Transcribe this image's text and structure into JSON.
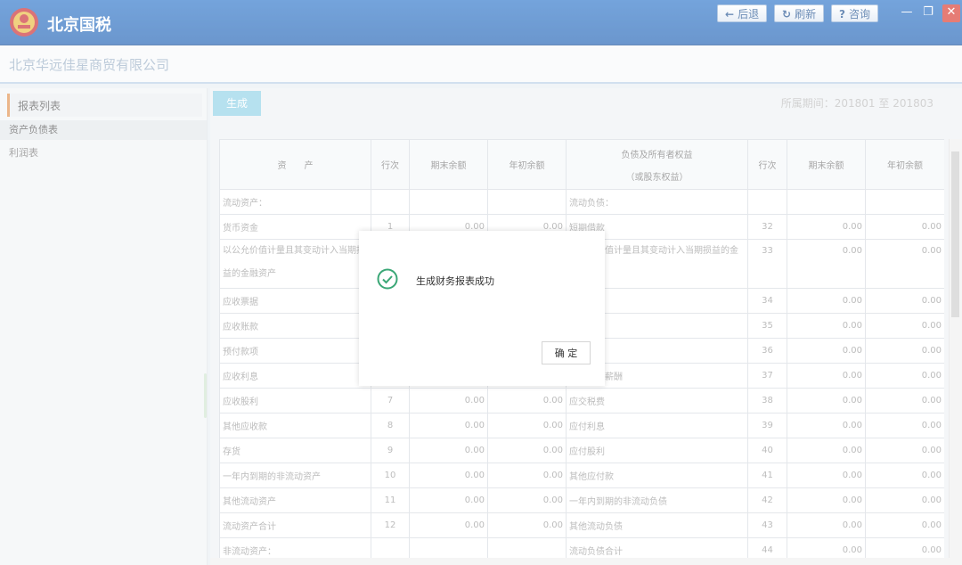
{
  "app": {
    "title": "北京国税"
  },
  "nav": {
    "back": "后退",
    "refresh": "刷新",
    "help": "咨询"
  },
  "company": {
    "name": "北京华远佳星商贸有限公司"
  },
  "sidebar": {
    "header": "报表列表",
    "items": [
      {
        "label": "资产负债表",
        "active": true
      },
      {
        "label": "利润表",
        "active": false
      }
    ]
  },
  "toolbar": {
    "generate": "生成",
    "period": "所属期间：201801 至 201803"
  },
  "table": {
    "headers": {
      "assets": "资　　产",
      "row_no": "行次",
      "end_balance": "期末余额",
      "begin_balance": "年初余额",
      "liabilities_line1": "负债及所有者权益",
      "liabilities_line2": "（或股东权益）"
    },
    "rows": [
      {
        "left": "流动资产：",
        "lno": "",
        "lend": "",
        "lbeg": "",
        "right": "流动负债：",
        "rno": "",
        "rend": "",
        "rbeg": ""
      },
      {
        "left": "货币资金",
        "lno": "1",
        "lend": "0.00",
        "lbeg": "0.00",
        "right": "短期借款",
        "rno": "32",
        "rend": "0.00",
        "rbeg": "0.00"
      },
      {
        "left": "以公允价值计量且其变动计入当期损益的金融资产",
        "lno": "",
        "lend": "",
        "lbeg": "",
        "right": "以公允价值计量且其变动计入当期损益的金融负债",
        "rno": "33",
        "rend": "0.00",
        "rbeg": "0.00",
        "tall": true
      },
      {
        "left": "应收票据",
        "lno": "",
        "lend": "",
        "lbeg": "",
        "right": "应付票据",
        "rno": "34",
        "rend": "0.00",
        "rbeg": "0.00"
      },
      {
        "left": "应收账款",
        "lno": "",
        "lend": "",
        "lbeg": "",
        "right": "应付账款",
        "rno": "35",
        "rend": "0.00",
        "rbeg": "0.00"
      },
      {
        "left": "预付款项",
        "lno": "",
        "lend": "",
        "lbeg": "",
        "right": "预收款项",
        "rno": "36",
        "rend": "0.00",
        "rbeg": "0.00"
      },
      {
        "left": "应收利息",
        "lno": "",
        "lend": "",
        "lbeg": "",
        "right": "应付职工薪酬",
        "rno": "37",
        "rend": "0.00",
        "rbeg": "0.00"
      },
      {
        "left": "应收股利",
        "lno": "7",
        "lend": "0.00",
        "lbeg": "0.00",
        "right": "应交税费",
        "rno": "38",
        "rend": "0.00",
        "rbeg": "0.00"
      },
      {
        "left": "其他应收款",
        "lno": "8",
        "lend": "0.00",
        "lbeg": "0.00",
        "right": "应付利息",
        "rno": "39",
        "rend": "0.00",
        "rbeg": "0.00"
      },
      {
        "left": "存货",
        "lno": "9",
        "lend": "0.00",
        "lbeg": "0.00",
        "right": "应付股利",
        "rno": "40",
        "rend": "0.00",
        "rbeg": "0.00"
      },
      {
        "left": "一年内到期的非流动资产",
        "lno": "10",
        "lend": "0.00",
        "lbeg": "0.00",
        "right": "其他应付款",
        "rno": "41",
        "rend": "0.00",
        "rbeg": "0.00"
      },
      {
        "left": "其他流动资产",
        "lno": "11",
        "lend": "0.00",
        "lbeg": "0.00",
        "right": "一年内到期的非流动负债",
        "rno": "42",
        "rend": "0.00",
        "rbeg": "0.00"
      },
      {
        "left": "流动资产合计",
        "lno": "12",
        "lend": "0.00",
        "lbeg": "0.00",
        "right": "其他流动负债",
        "rno": "43",
        "rend": "0.00",
        "rbeg": "0.00"
      },
      {
        "left": "非流动资产：",
        "lno": "",
        "lend": "",
        "lbeg": "",
        "right": "流动负债合计",
        "rno": "44",
        "rend": "0.00",
        "rbeg": "0.00"
      }
    ]
  },
  "dialog": {
    "message": "生成财务报表成功",
    "ok": "确 定"
  },
  "colors": {
    "brand": "#1f62b8",
    "success": "#3aa776",
    "close": "#d9362b"
  }
}
